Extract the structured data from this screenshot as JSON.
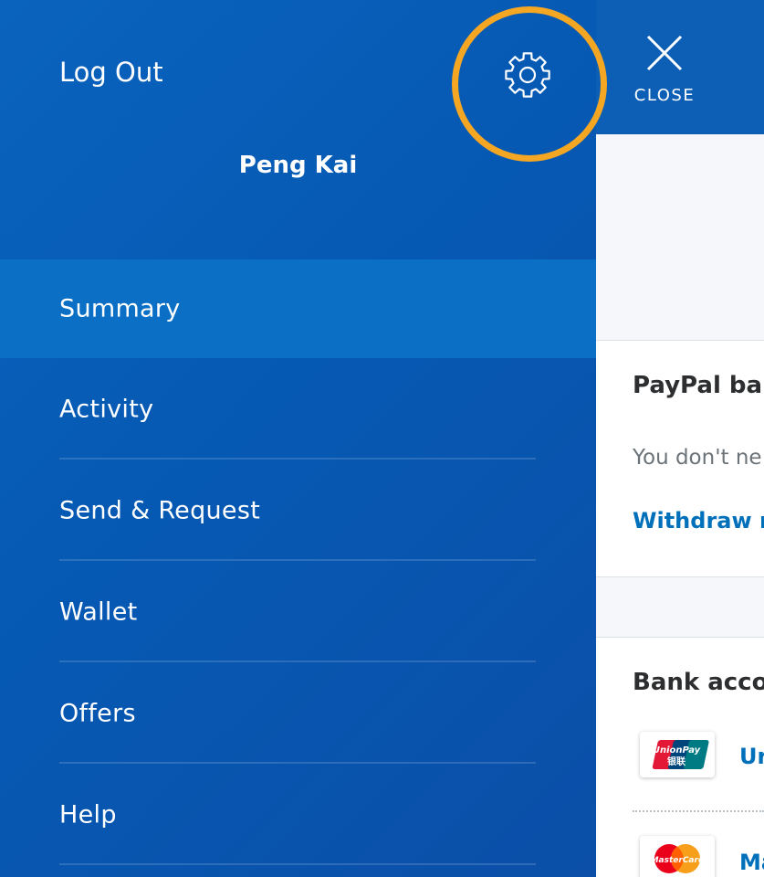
{
  "drawer": {
    "logout_label": "Log Out",
    "user_name": "Peng Kai",
    "menu": [
      {
        "label": "Summary",
        "active": true
      },
      {
        "label": "Activity",
        "active": false
      },
      {
        "label": "Send & Request",
        "active": false
      },
      {
        "label": "Wallet",
        "active": false
      },
      {
        "label": "Offers",
        "active": false
      },
      {
        "label": "Help",
        "active": false
      }
    ]
  },
  "topbar": {
    "close_label": "CLOSE"
  },
  "balance_card": {
    "title": "PayPal ba",
    "text": "You don't ne",
    "link": "Withdraw m"
  },
  "bank_card": {
    "title": "Bank acco",
    "accounts": [
      {
        "name": "Ur",
        "logo_text": "UnionPay"
      },
      {
        "name": "Ma",
        "logo_text": "MasterCard"
      }
    ]
  },
  "colors": {
    "drawer_blue": "#0a63bd",
    "active_item": "#0a6fc5",
    "highlight_ring": "#f5a623",
    "link_blue": "#0070ba"
  },
  "icons": {
    "settings": "gear-icon",
    "close": "close-icon",
    "unionpay": "unionpay-logo-icon",
    "mastercard": "mastercard-logo-icon"
  }
}
